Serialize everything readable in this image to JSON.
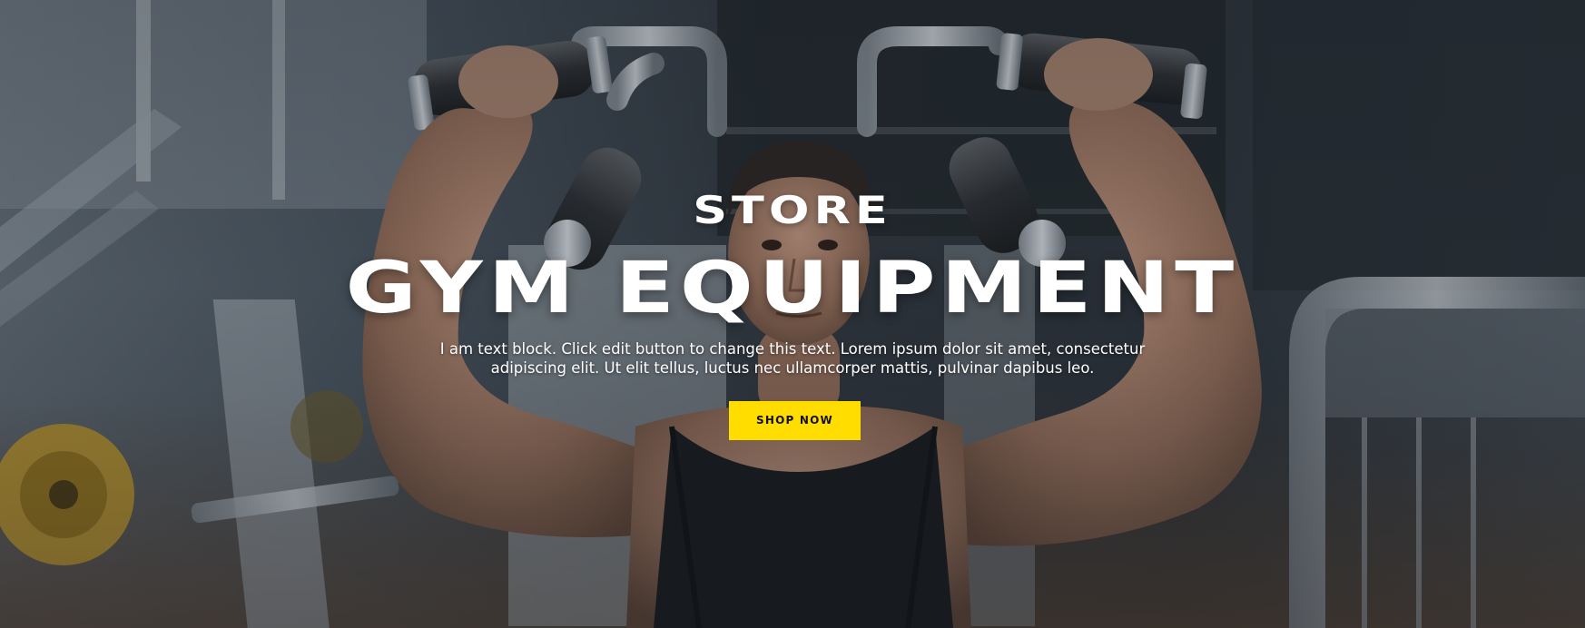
{
  "hero": {
    "eyebrow": "STORE",
    "headline": "GYM EQUIPMENT",
    "body": "I am text block. Click edit button to change this text. Lorem ipsum dolor sit amet, consectetur adipiscing elit. Ut elit tellus, luctus nec ullamcorper mattis, pulvinar dapibus leo.",
    "cta_label": "SHOP NOW"
  },
  "colors": {
    "cta_background": "#ffdd00",
    "cta_text": "#111111",
    "text": "#ffffff"
  }
}
